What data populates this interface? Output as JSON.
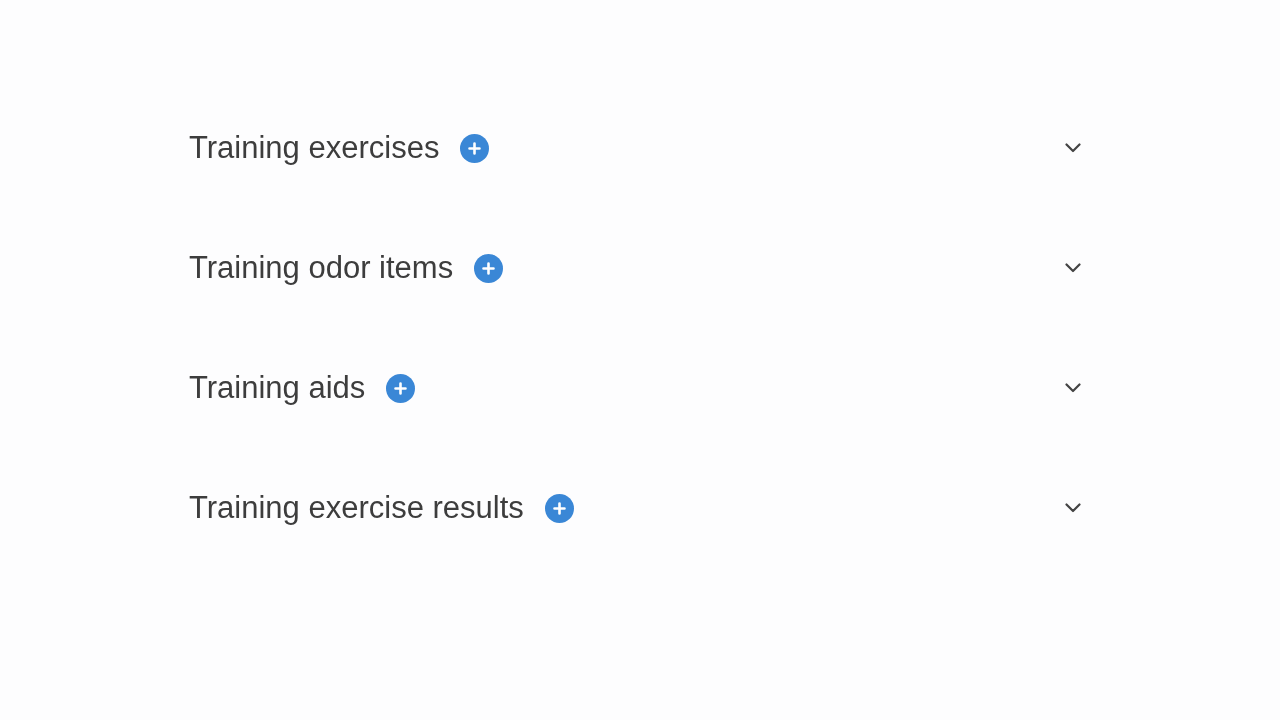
{
  "sections": [
    {
      "title": "Training exercises",
      "expanded": false
    },
    {
      "title": "Training odor items",
      "expanded": false
    },
    {
      "title": "Training aids",
      "expanded": false
    },
    {
      "title": "Training exercise results",
      "expanded": false
    }
  ]
}
